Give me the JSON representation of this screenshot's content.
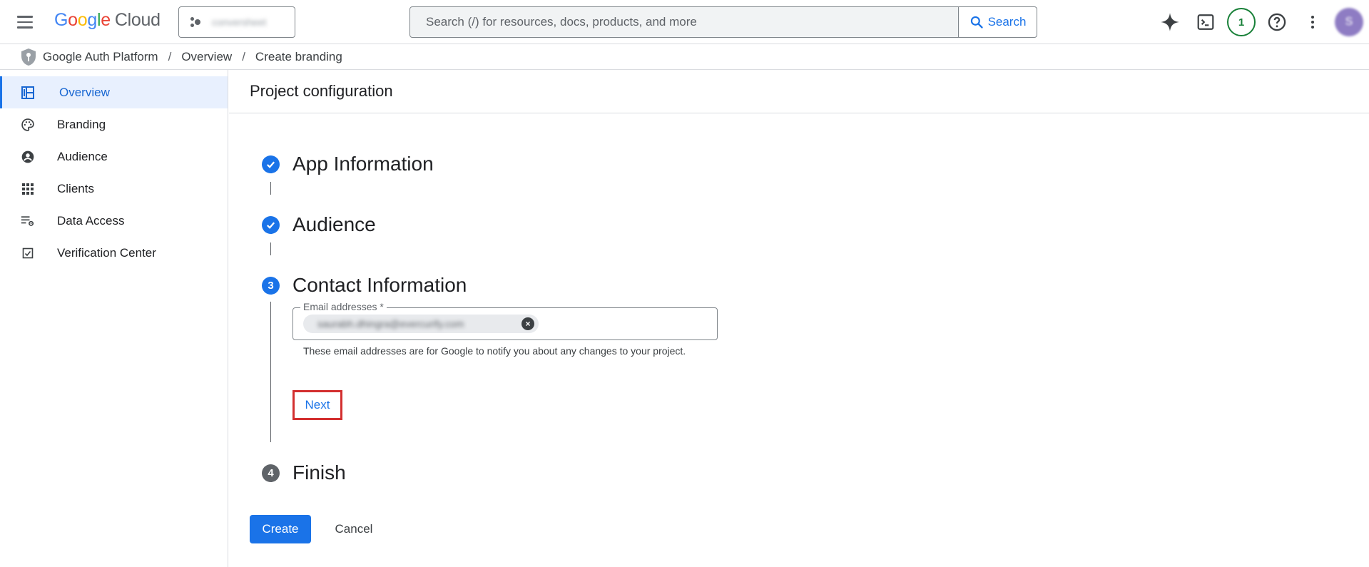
{
  "header": {
    "logo_google": [
      "G",
      "o",
      "o",
      "g",
      "l",
      "e"
    ],
    "logo_cloud": "Cloud",
    "project_name": "conversheet",
    "search_placeholder": "Search (/) for resources, docs, products, and more",
    "search_button_label": "Search",
    "notification_count": "1",
    "avatar_initial": "S"
  },
  "breadcrumb": {
    "items": [
      "Google Auth Platform",
      "Overview",
      "Create branding"
    ],
    "separator": "/"
  },
  "sidebar": {
    "items": [
      {
        "label": "Overview",
        "icon": "dashboard-icon",
        "active": true
      },
      {
        "label": "Branding",
        "icon": "palette-icon",
        "active": false
      },
      {
        "label": "Audience",
        "icon": "account-circle-icon",
        "active": false
      },
      {
        "label": "Clients",
        "icon": "apps-grid-icon",
        "active": false
      },
      {
        "label": "Data Access",
        "icon": "list-settings-icon",
        "active": false
      },
      {
        "label": "Verification Center",
        "icon": "checkbox-icon",
        "active": false
      }
    ]
  },
  "main": {
    "page_title": "Project configuration",
    "steps": [
      {
        "number": "1",
        "label": "App Information",
        "state": "done"
      },
      {
        "number": "2",
        "label": "Audience",
        "state": "done"
      },
      {
        "number": "3",
        "label": "Contact Information",
        "state": "current"
      },
      {
        "number": "4",
        "label": "Finish",
        "state": "todo"
      }
    ],
    "email_field": {
      "label": "Email addresses *",
      "chip_value": "saurabh.dhingra@evercurify.com"
    },
    "helper_text": "These email addresses are for Google to notify you about any changes to your project.",
    "next_label": "Next",
    "create_label": "Create",
    "cancel_label": "Cancel"
  },
  "colors": {
    "accent": "#1a73e8",
    "highlight_border": "#d32f2f",
    "active_nav_bg": "#e8f0fe"
  }
}
